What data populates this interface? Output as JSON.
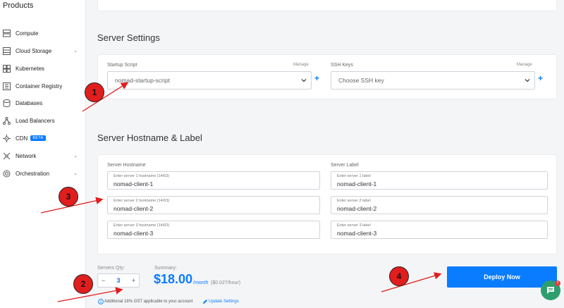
{
  "sidebar": {
    "title": "Products",
    "items": [
      {
        "label": "Compute",
        "icon": "server-icon",
        "expandable": false
      },
      {
        "label": "Cloud Storage",
        "icon": "storage-icon",
        "expandable": true
      },
      {
        "label": "Kubernetes",
        "icon": "kubernetes-icon",
        "expandable": false
      },
      {
        "label": "Container Registry",
        "icon": "registry-icon",
        "expandable": false
      },
      {
        "label": "Databases",
        "icon": "database-icon",
        "expandable": false
      },
      {
        "label": "Load Balancers",
        "icon": "load-balancer-icon",
        "expandable": false
      },
      {
        "label": "CDN",
        "icon": "cdn-icon",
        "expandable": false,
        "badge": "BETA"
      },
      {
        "label": "Network",
        "icon": "network-icon",
        "expandable": true
      },
      {
        "label": "Orchestration",
        "icon": "orchestration-icon",
        "expandable": true
      }
    ]
  },
  "server_settings": {
    "title": "Server Settings",
    "startup_script": {
      "label": "Startup Script",
      "manage": "Manage",
      "value": "nomad-startup-script"
    },
    "ssh_keys": {
      "label": "SSH Keys",
      "manage": "Manage",
      "placeholder": "Choose SSH key"
    }
  },
  "hostname_label": {
    "title": "Server Hostname & Label",
    "hostname_header": "Server Hostname",
    "label_header": "Server Label",
    "servers": [
      {
        "hostname_hint": "Enter server 1 hostname (14/63)",
        "hostname": "nomad-client-1",
        "label_hint": "Enter server 1 label",
        "label": "nomad-client-1"
      },
      {
        "hostname_hint": "Enter server 2 hostname (14/63)",
        "hostname": "nomad-client-2",
        "label_hint": "Enter server 2 label",
        "label": "nomad-client-2"
      },
      {
        "hostname_hint": "Enter server 3 hostname (14/63)",
        "hostname": "nomad-client-3",
        "label_hint": "Enter server 3 label",
        "label": "nomad-client-3"
      }
    ]
  },
  "footer": {
    "qty_label": "Servers Qty:",
    "qty_minus": "−",
    "qty_value": "3",
    "qty_plus": "+",
    "summary_label": "Summary:",
    "price": "$18.00",
    "price_period": "/month",
    "price_hourly": "($0.027/hour)",
    "deploy_label": "Deploy Now",
    "gst_note": "Additional 18% GST applicable to your account",
    "update_settings": "Update Settings"
  },
  "chat": {
    "badge_count": "7"
  },
  "annotations": [
    "1",
    "2",
    "3",
    "4"
  ],
  "colors": {
    "accent": "#0a7cff",
    "annotation": "#e21d1d",
    "chat": "#2e9e6f"
  }
}
